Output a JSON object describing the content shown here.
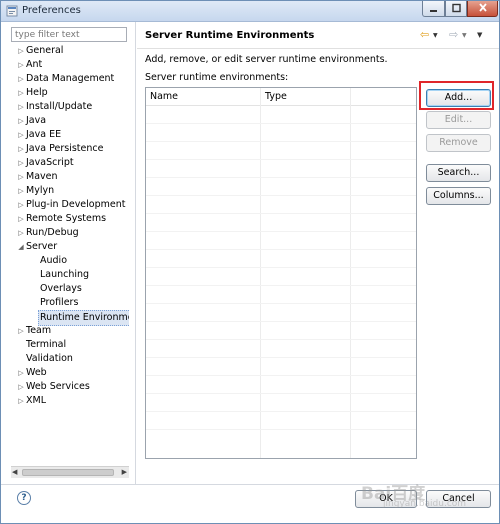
{
  "window": {
    "title": "Preferences"
  },
  "filter": {
    "placeholder": "type filter text"
  },
  "tree": {
    "items": [
      {
        "label": "General",
        "expander": "▷"
      },
      {
        "label": "Ant",
        "expander": "▷"
      },
      {
        "label": "Data Management",
        "expander": "▷"
      },
      {
        "label": "Help",
        "expander": "▷"
      },
      {
        "label": "Install/Update",
        "expander": "▷"
      },
      {
        "label": "Java",
        "expander": "▷"
      },
      {
        "label": "Java EE",
        "expander": "▷"
      },
      {
        "label": "Java Persistence",
        "expander": "▷"
      },
      {
        "label": "JavaScript",
        "expander": "▷"
      },
      {
        "label": "Maven",
        "expander": "▷"
      },
      {
        "label": "Mylyn",
        "expander": "▷"
      },
      {
        "label": "Plug-in Development",
        "expander": "▷"
      },
      {
        "label": "Remote Systems",
        "expander": "▷"
      },
      {
        "label": "Run/Debug",
        "expander": "▷"
      },
      {
        "label": "Server",
        "expander": "◢"
      },
      {
        "label": "Audio",
        "expander": ""
      },
      {
        "label": "Launching",
        "expander": ""
      },
      {
        "label": "Overlays",
        "expander": ""
      },
      {
        "label": "Profilers",
        "expander": ""
      },
      {
        "label": "Runtime Environment",
        "expander": ""
      },
      {
        "label": "Team",
        "expander": "▷"
      },
      {
        "label": "Terminal",
        "expander": ""
      },
      {
        "label": "Validation",
        "expander": ""
      },
      {
        "label": "Web",
        "expander": "▷"
      },
      {
        "label": "Web Services",
        "expander": "▷"
      },
      {
        "label": "XML",
        "expander": "▷"
      }
    ]
  },
  "page": {
    "title": "Server Runtime Environments",
    "description": "Add, remove, or edit server runtime environments.",
    "list_label": "Server runtime environments:",
    "columns": [
      "Name",
      "Type"
    ]
  },
  "buttons": {
    "add": "Add...",
    "edit": "Edit...",
    "remove": "Remove",
    "search": "Search...",
    "columns": "Columns..."
  },
  "footer": {
    "ok": "OK",
    "cancel": "Cancel",
    "help": "?"
  },
  "watermark": {
    "main": "Bai百度",
    "sub": "jingyan.baidu.com"
  },
  "colors": {
    "highlight": "#e0262a",
    "selection": "#dbe5f3"
  }
}
